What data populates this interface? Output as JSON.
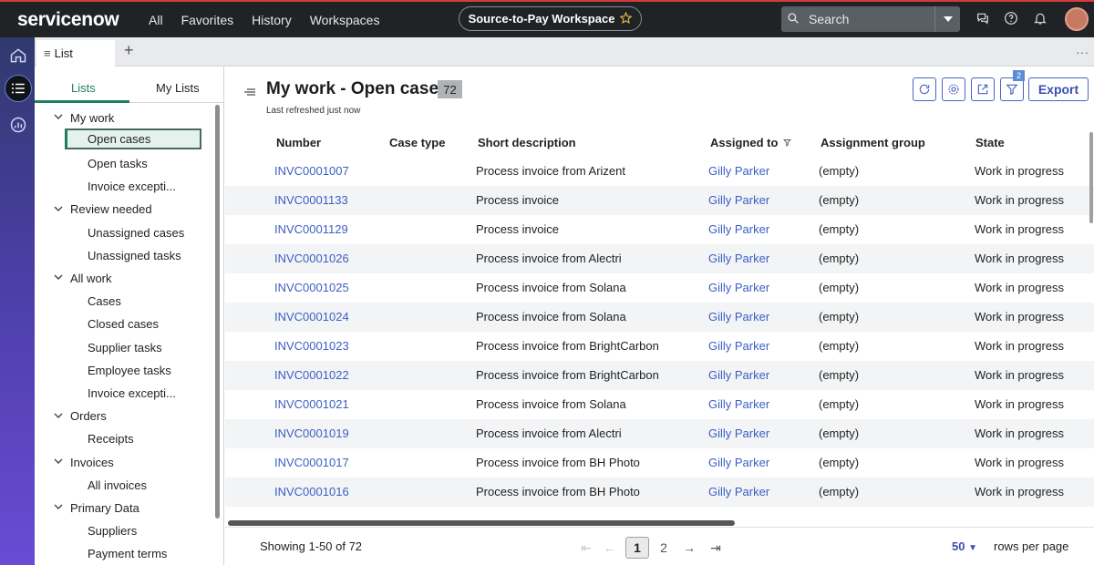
{
  "topnav": {
    "logo": "servicenow",
    "links": [
      "All",
      "Favorites",
      "History",
      "Workspaces"
    ],
    "workspace": "Source-to-Pay Workspace",
    "search_placeholder": "Search"
  },
  "tabstrip": {
    "active_tab": "List",
    "add_symbol": "+",
    "more_symbol": "···"
  },
  "left_panel": {
    "tabs": [
      "Lists",
      "My Lists"
    ],
    "tree": [
      {
        "type": "group",
        "label": "My work"
      },
      {
        "type": "leaf",
        "label": "Open cases",
        "selected": true
      },
      {
        "type": "leaf",
        "label": "Open tasks"
      },
      {
        "type": "leaf",
        "label": "Invoice excepti..."
      },
      {
        "type": "group",
        "label": "Review needed"
      },
      {
        "type": "leaf",
        "label": "Unassigned cases"
      },
      {
        "type": "leaf",
        "label": "Unassigned tasks"
      },
      {
        "type": "group",
        "label": "All work"
      },
      {
        "type": "leaf",
        "label": "Cases"
      },
      {
        "type": "leaf",
        "label": "Closed cases"
      },
      {
        "type": "leaf",
        "label": "Supplier tasks"
      },
      {
        "type": "leaf",
        "label": "Employee tasks"
      },
      {
        "type": "leaf",
        "label": "Invoice excepti..."
      },
      {
        "type": "group",
        "label": "Orders"
      },
      {
        "type": "leaf",
        "label": "Receipts"
      },
      {
        "type": "group",
        "label": "Invoices"
      },
      {
        "type": "leaf",
        "label": "All invoices"
      },
      {
        "type": "group",
        "label": "Primary Data"
      },
      {
        "type": "leaf",
        "label": "Suppliers"
      },
      {
        "type": "leaf",
        "label": "Payment terms"
      }
    ]
  },
  "main": {
    "title": "My work - Open cases",
    "count": "72",
    "refreshed": "Last refreshed just now",
    "filter_count": "2",
    "export_label": "Export",
    "columns": [
      "Number",
      "Case type",
      "Short description",
      "Assigned to",
      "Assignment group",
      "State"
    ],
    "rows": [
      [
        "INVC0001007",
        "",
        "Process invoice from Arizent",
        "Gilly Parker",
        "(empty)",
        "Work in progress"
      ],
      [
        "INVC0001133",
        "",
        "Process invoice",
        "Gilly Parker",
        "(empty)",
        "Work in progress"
      ],
      [
        "INVC0001129",
        "",
        "Process invoice",
        "Gilly Parker",
        "(empty)",
        "Work in progress"
      ],
      [
        "INVC0001026",
        "",
        "Process invoice from Alectri",
        "Gilly Parker",
        "(empty)",
        "Work in progress"
      ],
      [
        "INVC0001025",
        "",
        "Process invoice from Solana",
        "Gilly Parker",
        "(empty)",
        "Work in progress"
      ],
      [
        "INVC0001024",
        "",
        "Process invoice from Solana",
        "Gilly Parker",
        "(empty)",
        "Work in progress"
      ],
      [
        "INVC0001023",
        "",
        "Process invoice from BrightCarbon",
        "Gilly Parker",
        "(empty)",
        "Work in progress"
      ],
      [
        "INVC0001022",
        "",
        "Process invoice from BrightCarbon",
        "Gilly Parker",
        "(empty)",
        "Work in progress"
      ],
      [
        "INVC0001021",
        "",
        "Process invoice from Solana",
        "Gilly Parker",
        "(empty)",
        "Work in progress"
      ],
      [
        "INVC0001019",
        "",
        "Process invoice from Alectri",
        "Gilly Parker",
        "(empty)",
        "Work in progress"
      ],
      [
        "INVC0001017",
        "",
        "Process invoice from BH Photo",
        "Gilly Parker",
        "(empty)",
        "Work in progress"
      ],
      [
        "INVC0001016",
        "",
        "Process invoice from BH Photo",
        "Gilly Parker",
        "(empty)",
        "Work in progress"
      ]
    ],
    "pagination": {
      "showing": "Showing 1-50 of 72",
      "pages": [
        "1",
        "2"
      ],
      "current_page": "1",
      "rows_per_page": "50",
      "rows_per_page_label": "rows per page"
    }
  },
  "colors": {
    "accent_green": "#217e59",
    "link_blue": "#3b5fc4",
    "nav_bg": "#1f2326"
  }
}
